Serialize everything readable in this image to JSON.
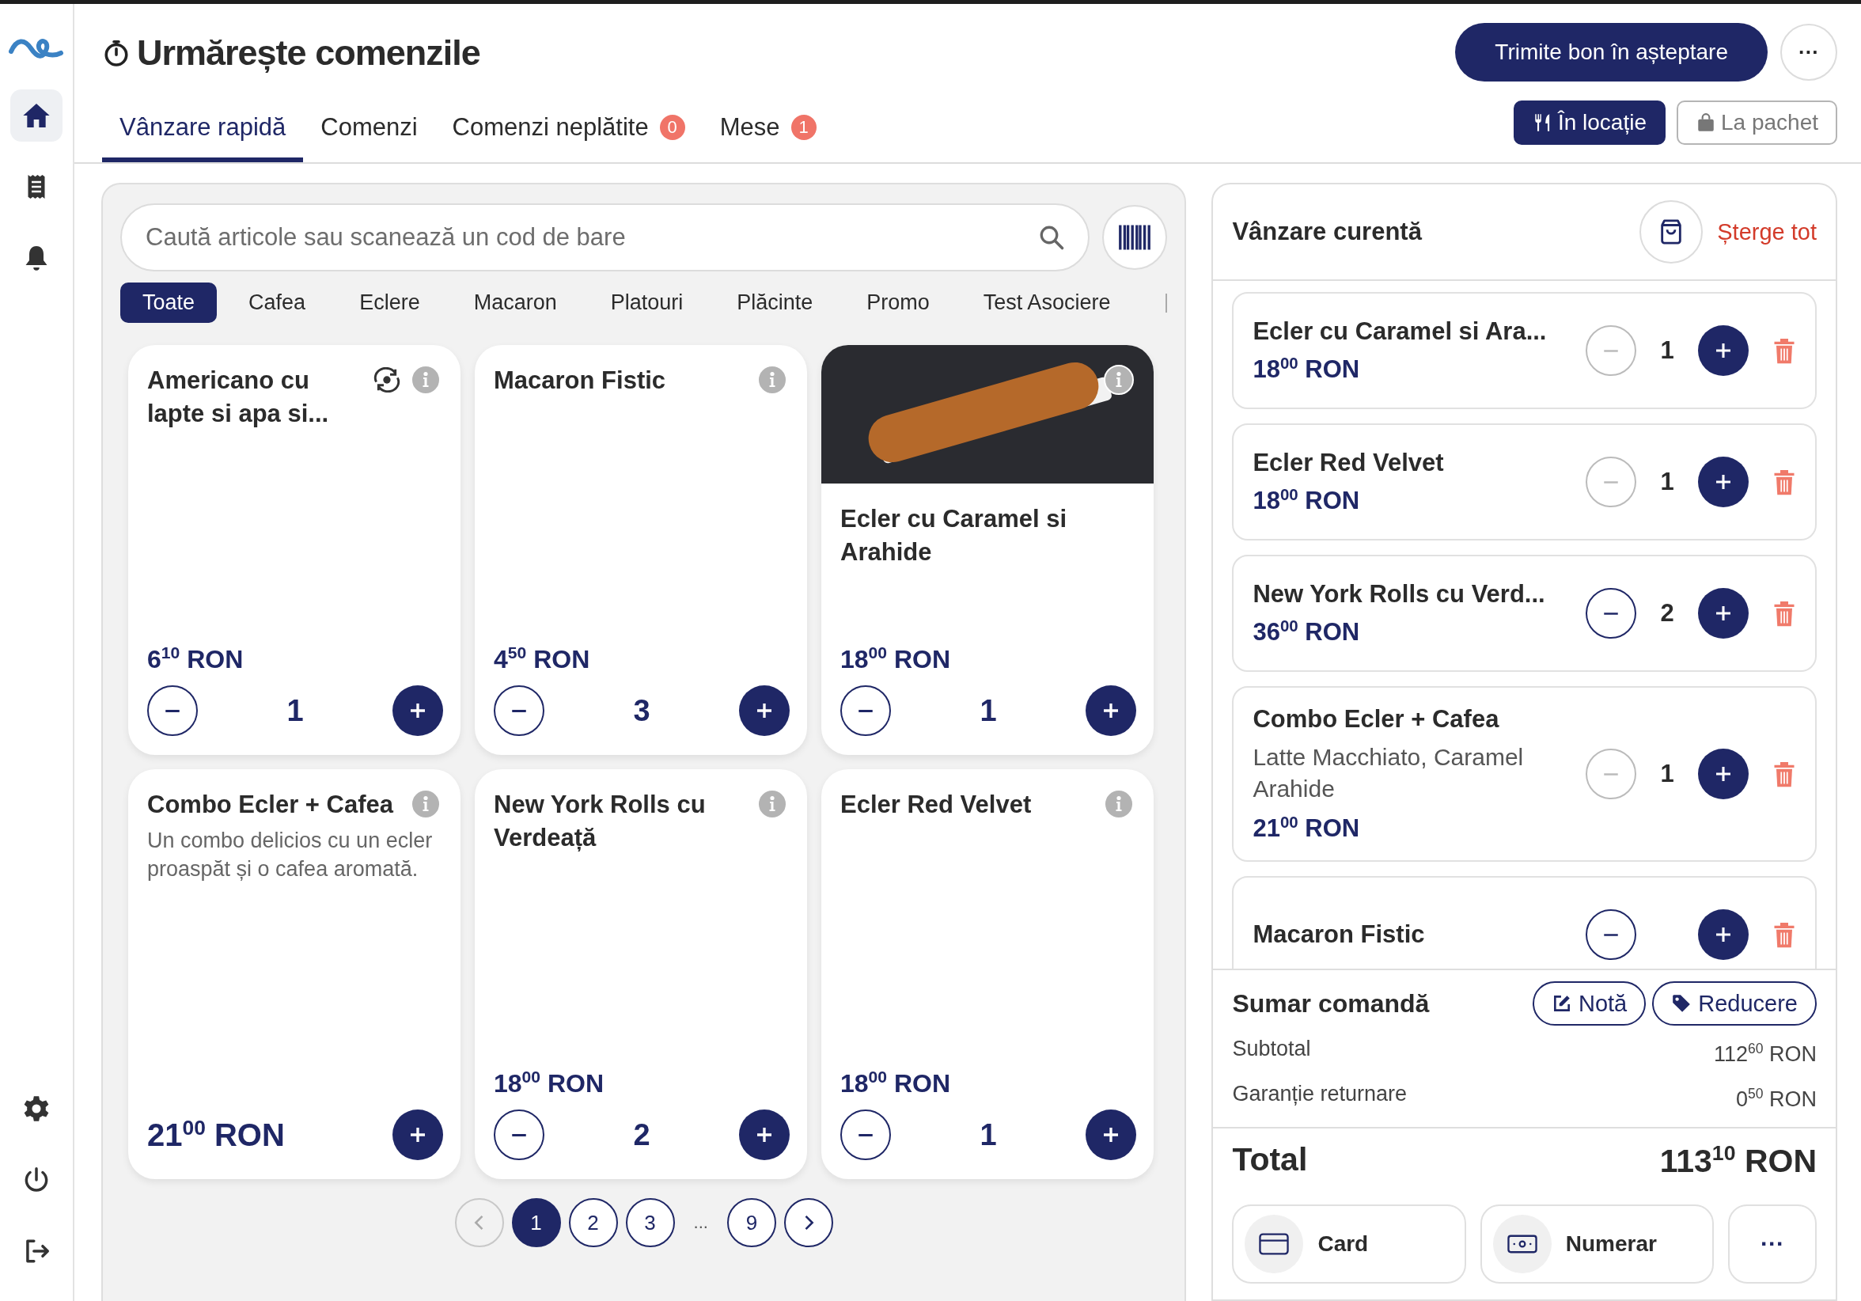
{
  "sidebar": {
    "items": [
      {
        "kind": "home",
        "selected": true
      },
      {
        "kind": "receipt",
        "selected": false
      },
      {
        "kind": "bell",
        "selected": false
      }
    ],
    "bottom_items": [
      {
        "kind": "settings"
      },
      {
        "kind": "power"
      },
      {
        "kind": "logout"
      }
    ]
  },
  "header": {
    "title": "Urmărește comenzile",
    "primary_button": "Trimite bon în așteptare",
    "more_button": "···"
  },
  "tabs": [
    {
      "label": "Vânzare rapidă",
      "selected": true
    },
    {
      "label": "Comenzi",
      "selected": false
    },
    {
      "label": "Comenzi neplătite",
      "badge": "0",
      "selected": false
    },
    {
      "label": "Mese",
      "badge": "1",
      "selected": false
    }
  ],
  "order_types": [
    {
      "kind": "dine_in",
      "label": "În locație",
      "selected": true
    },
    {
      "kind": "takeaway",
      "label": "La pachet",
      "selected": false
    }
  ],
  "search": {
    "placeholder": "Caută articole sau scanează un cod de bare"
  },
  "categories": [
    {
      "label": "Toate",
      "selected": true
    },
    {
      "label": "Cafea",
      "selected": false
    },
    {
      "label": "Eclere",
      "selected": false
    },
    {
      "label": "Macaron",
      "selected": false
    },
    {
      "label": "Platouri",
      "selected": false
    },
    {
      "label": "Plăcinte",
      "selected": false
    },
    {
      "label": "Promo",
      "selected": false
    },
    {
      "label": "Test Asociere",
      "selected": false
    }
  ],
  "products": [
    {
      "name": "Americano cu lapte si apa si...",
      "price": "6$^{10}$ RON",
      "quantity": "1",
      "exchange": true,
      "photo": false
    },
    {
      "name": "Macaron Fistic",
      "price": "4$^{50}$ RON",
      "quantity": "3",
      "exchange": false,
      "photo": false
    },
    {
      "name": "Ecler cu Caramel si Arahide",
      "price": "18$^{00}$ RON",
      "quantity": "1",
      "exchange": false,
      "photo": true
    },
    {
      "name": "Combo Ecler + Cafea",
      "description": "Un combo delicios cu un ecler proaspăt și o cafea aromată.",
      "price": "21$^{00}$ RON",
      "exchange": false,
      "photo": false
    },
    {
      "name": "New York Rolls cu Verdeață",
      "price": "18$^{00}$ RON",
      "quantity": "2",
      "exchange": false,
      "photo": false
    },
    {
      "name": "Ecler Red Velvet",
      "price": "18$^{00}$ RON",
      "quantity": "1",
      "exchange": false,
      "photo": false
    }
  ],
  "pagination": {
    "pages": [
      {
        "label": "1",
        "selected": true
      },
      {
        "label": "2",
        "selected": false
      },
      {
        "label": "3",
        "selected": false
      },
      {
        "label": "...",
        "kind": "gap"
      },
      {
        "label": "9",
        "selected": false
      }
    ],
    "prev_disabled": true
  },
  "cart": {
    "title": "Vânzare curentă",
    "clear_link": "Șterge tot",
    "items": [
      {
        "name": "Ecler cu Caramel si Ara...",
        "price": "18$^{00}$ RON",
        "quantity": "1",
        "minus_disabled": true
      },
      {
        "name": "Ecler Red Velvet",
        "price": "18$^{00}$ RON",
        "quantity": "1",
        "minus_disabled": true
      },
      {
        "name": "New York Rolls cu Verd...",
        "price": "36$^{00}$ RON",
        "quantity": "2",
        "minus_disabled": false
      },
      {
        "name": "Combo Ecler + Cafea",
        "description": "Latte Macchiato, Caramel Arahide",
        "price": "21$^{00}$ RON",
        "quantity": "1",
        "minus_disabled": true
      },
      {
        "name": "Macaron Fistic",
        "minus_disabled": false
      }
    ]
  },
  "summary": {
    "title": "Sumar comandă",
    "note_button": "Notă",
    "discount_button": "Reducere",
    "lines": [
      {
        "label": "Subtotal",
        "value": "112$^{60}$ RON"
      },
      {
        "label": "Garanție returnare",
        "value": "0$^{50}$ RON"
      }
    ],
    "total_label": "Total",
    "total_value": "113$^{10}$ RON"
  },
  "payments": [
    {
      "kind": "card",
      "label": "Card"
    },
    {
      "kind": "cash",
      "label": "Numerar"
    },
    {
      "kind": "more",
      "label": "···"
    }
  ]
}
